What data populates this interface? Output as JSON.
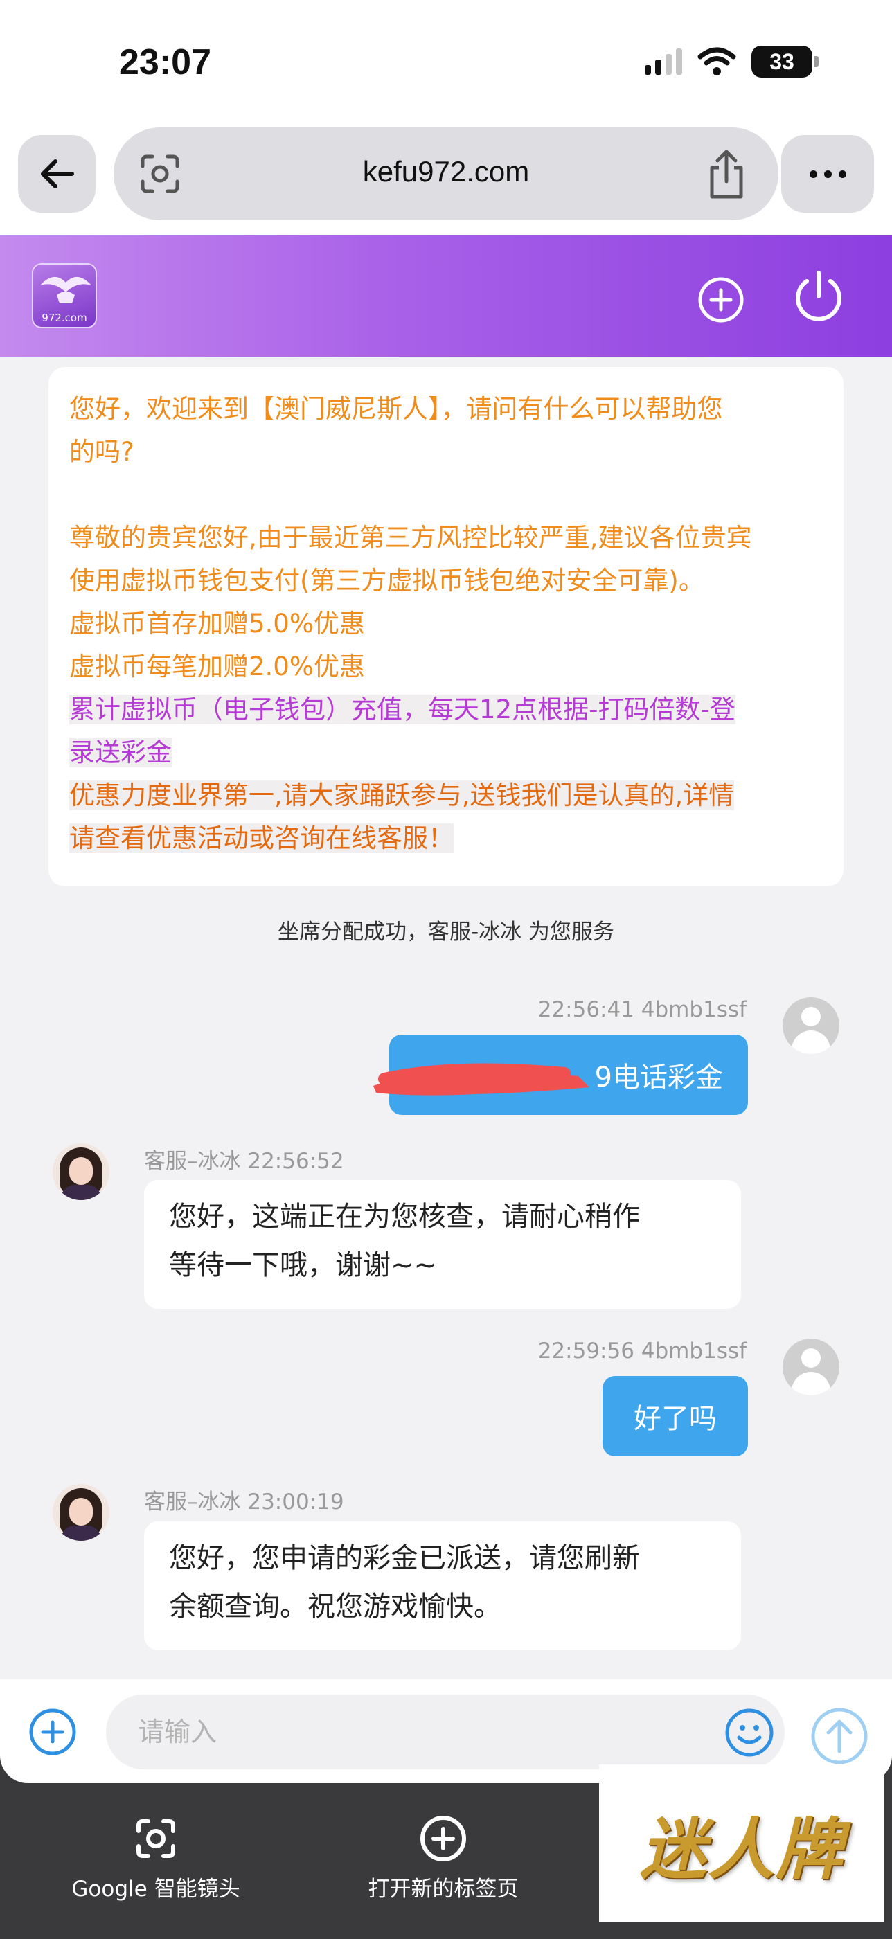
{
  "status_bar": {
    "time": "23:07",
    "battery": "33"
  },
  "browser": {
    "url": "kefu972.com"
  },
  "header": {
    "logo_text": "972.com"
  },
  "welcome": {
    "line1": "您好，欢迎来到【澳门威尼斯人】，请问有什么可以帮助您",
    "line2": "的吗?",
    "line3": "尊敬的贵宾您好,由于最近第三方风控比较严重,建议各位贵宾",
    "line4": "使用虚拟币钱包支付(第三方虚拟币钱包绝对安全可靠)。",
    "line5": "虚拟币首存加赠5.0%优惠",
    "line6": "虚拟币每笔加赠2.0%优惠",
    "promo_purple_1": "累计虚拟币（电子钱包）充值，每天12点根据-打码倍数-登",
    "promo_purple_2": "录送彩金",
    "promo_orange_1": "优惠力度业界第一,请大家踊跃参与,送钱我们是认真的,详情",
    "promo_orange_2": "请查看优惠活动或咨询在线客服！"
  },
  "system_message": "坐席分配成功，客服-冰冰 为您服务",
  "messages": [
    {
      "meta": "22:56:41 4bmb1ssf",
      "text": "9电话彩金"
    },
    {
      "meta": "客服–冰冰 22:56:52",
      "line1": "您好，这端正在为您核查，请耐心稍作",
      "line2": "等待一下哦，谢谢~~"
    },
    {
      "meta": "22:59:56 4bmb1ssf",
      "text": "好了吗"
    },
    {
      "meta": "客服–冰冰 23:00:19",
      "line1": "您好，您申请的彩金已派送，请您刷新",
      "line2": "余额查询。祝您游戏愉快。"
    }
  ],
  "input": {
    "placeholder": "请输入"
  },
  "bottom_toolbar": {
    "lens_label": "Google 智能镜头",
    "new_tab_label": "打开新的标签页"
  },
  "watermark": "迷人牌",
  "colors": {
    "header_start": "#c48aee",
    "header_end": "#8d3fdf",
    "user_bubble": "#3fa5ec",
    "welcome_text": "#f08c1b",
    "promo_purple": "#b63ad6",
    "promo_orange": "#e36a10"
  }
}
